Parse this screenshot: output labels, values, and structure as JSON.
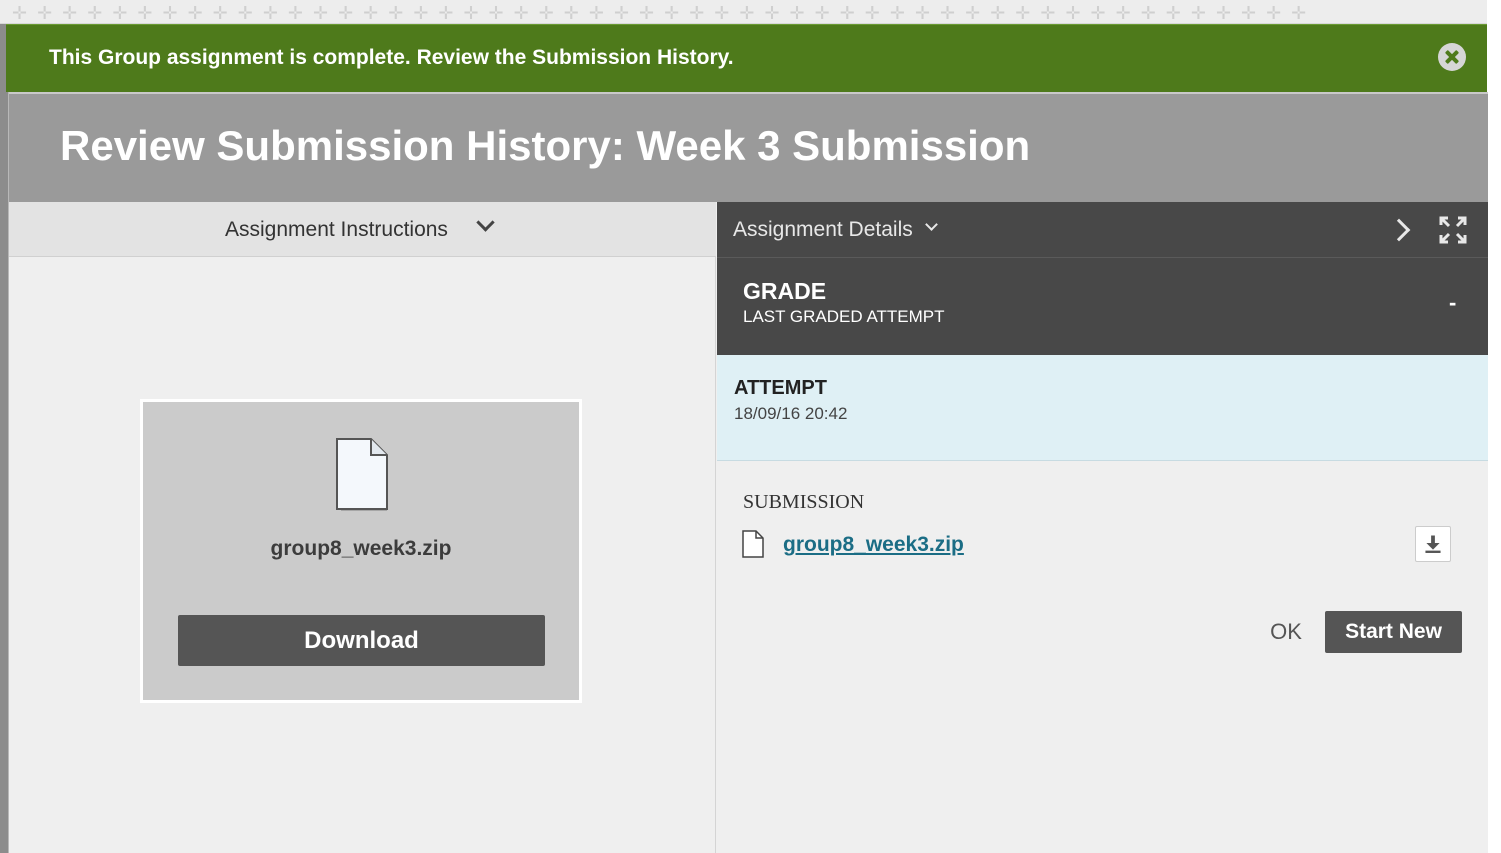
{
  "alert": {
    "message": "This Group assignment is complete. Review the Submission History.",
    "close_icon": "close-circle-icon"
  },
  "panel": {
    "title": "Review Submission History: Week 3 Submission"
  },
  "left": {
    "instructions_label": "Assignment Instructions",
    "file_name": "group8_week3.zip",
    "download_label": "Download"
  },
  "right": {
    "details_label": "Assignment Details",
    "grade": {
      "title": "GRADE",
      "subtitle": "LAST GRADED ATTEMPT",
      "value": "-"
    },
    "attempt": {
      "title": "ATTEMPT",
      "date": "18/09/16 20:42"
    },
    "submission": {
      "label": "SUBMISSION",
      "file_name": "group8_week3.zip"
    },
    "ok_label": "OK",
    "start_new_label": "Start New"
  },
  "colors": {
    "alert_bg": "#4e7a1b",
    "header_bg": "#9a9a9a",
    "dark_bar": "#484848",
    "attempt_bg": "#dff0f5",
    "link": "#1b6d85",
    "button_bg": "#555555"
  }
}
